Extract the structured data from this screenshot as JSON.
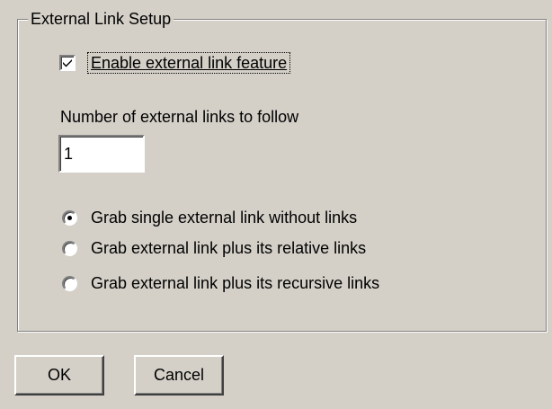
{
  "group": {
    "title": "External Link Setup"
  },
  "enable_checkbox": {
    "label": "Enable external link feature",
    "checked": true
  },
  "links_field": {
    "label": "Number of external links to follow",
    "value": "1"
  },
  "grab_options": [
    {
      "label": "Grab single external link without links",
      "selected": true
    },
    {
      "label": "Grab external link plus its relative links",
      "selected": false
    },
    {
      "label": "Grab external link plus its recursive links",
      "selected": false
    }
  ],
  "buttons": {
    "ok_label": "OK",
    "cancel_label": "Cancel"
  }
}
